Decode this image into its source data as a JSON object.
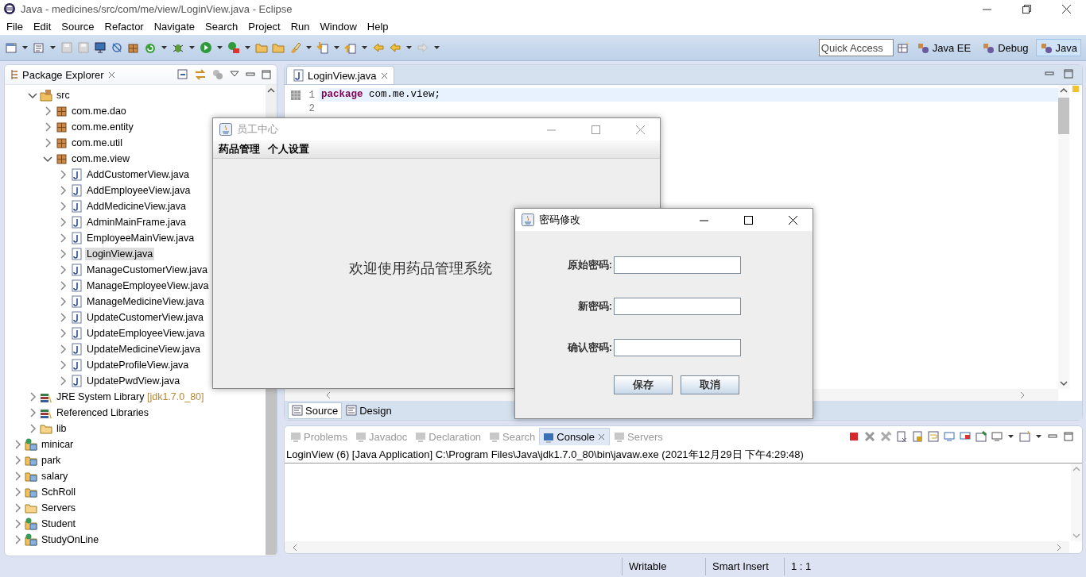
{
  "window": {
    "title": "Java - medicines/src/com/me/view/LoginView.java - Eclipse"
  },
  "menu": [
    "File",
    "Edit",
    "Source",
    "Refactor",
    "Navigate",
    "Search",
    "Project",
    "Run",
    "Window",
    "Help"
  ],
  "quick_access": {
    "placeholder": "Quick Access"
  },
  "perspectives": [
    {
      "label": "Java EE",
      "selected": false
    },
    {
      "label": "Debug",
      "selected": false
    },
    {
      "label": "Java",
      "selected": true
    }
  ],
  "package_explorer": {
    "title": "Package Explorer",
    "project_contents": [
      {
        "label": "src",
        "kind": "source-folder",
        "expanded": true,
        "selected": false,
        "children": [
          {
            "label": "com.me.dao",
            "kind": "package",
            "expanded": false,
            "selected": false
          },
          {
            "label": "com.me.entity",
            "kind": "package",
            "expanded": false,
            "selected": false
          },
          {
            "label": "com.me.util",
            "kind": "package",
            "expanded": false,
            "selected": false
          },
          {
            "label": "com.me.view",
            "kind": "package",
            "expanded": true,
            "selected": false,
            "children": [
              {
                "label": "AddCustomerView.java",
                "kind": "java-file",
                "expanded": false,
                "selected": false
              },
              {
                "label": "AddEmployeeView.java",
                "kind": "java-file",
                "expanded": false,
                "selected": false
              },
              {
                "label": "AddMedicineView.java",
                "kind": "java-file",
                "expanded": false,
                "selected": false
              },
              {
                "label": "AdminMainFrame.java",
                "kind": "java-file",
                "expanded": false,
                "selected": false
              },
              {
                "label": "EmployeeMainView.java",
                "kind": "java-file",
                "expanded": false,
                "selected": false
              },
              {
                "label": "LoginView.java",
                "kind": "java-file",
                "expanded": false,
                "selected": true
              },
              {
                "label": "ManageCustomerView.java",
                "kind": "java-file",
                "expanded": false,
                "selected": false
              },
              {
                "label": "ManageEmployeeView.java",
                "kind": "java-file",
                "expanded": false,
                "selected": false
              },
              {
                "label": "ManageMedicineView.java",
                "kind": "java-file",
                "expanded": false,
                "selected": false
              },
              {
                "label": "UpdateCustomerView.java",
                "kind": "java-file",
                "expanded": false,
                "selected": false
              },
              {
                "label": "UpdateEmployeeView.java",
                "kind": "java-file",
                "expanded": false,
                "selected": false
              },
              {
                "label": "UpdateMedicineView.java",
                "kind": "java-file",
                "expanded": false,
                "selected": false
              },
              {
                "label": "UpdateProfileView.java",
                "kind": "java-file",
                "expanded": false,
                "selected": false
              },
              {
                "label": "UpdatePwdView.java",
                "kind": "java-file",
                "expanded": false,
                "selected": false
              }
            ]
          }
        ]
      },
      {
        "label": "JRE System Library",
        "decoration": "[jdk1.7.0_80]",
        "kind": "library",
        "expanded": false,
        "selected": false
      },
      {
        "label": "Referenced Libraries",
        "kind": "library",
        "expanded": false,
        "selected": false
      },
      {
        "label": "lib",
        "kind": "folder",
        "expanded": false,
        "selected": false
      }
    ],
    "projects": [
      {
        "label": "minicar",
        "kind": "web-project",
        "expanded": false,
        "selected": false
      },
      {
        "label": "park",
        "kind": "project",
        "expanded": false,
        "selected": false
      },
      {
        "label": "salary",
        "kind": "project",
        "expanded": false,
        "selected": false
      },
      {
        "label": "SchRoll",
        "kind": "project",
        "expanded": false,
        "selected": false
      },
      {
        "label": "Servers",
        "kind": "folder",
        "expanded": false,
        "selected": false
      },
      {
        "label": "Student",
        "kind": "web-project",
        "expanded": false,
        "selected": false
      },
      {
        "label": "StudyOnLine",
        "kind": "web-project",
        "expanded": false,
        "selected": false
      }
    ]
  },
  "editor": {
    "tab": "LoginView.java",
    "lines": [
      {
        "number": "1",
        "current": true,
        "tokens": [
          {
            "kind": "keyword",
            "text": "package"
          },
          {
            "kind": "plain",
            "text": " com.me.view;"
          }
        ]
      },
      {
        "number": "2",
        "current": false
      }
    ],
    "bottom_tabs": [
      {
        "label": "Source",
        "selected": true
      },
      {
        "label": "Design",
        "selected": false
      }
    ]
  },
  "console": {
    "tabs": [
      {
        "label": "Problems",
        "selected": false
      },
      {
        "label": "Javadoc",
        "selected": false
      },
      {
        "label": "Declaration",
        "selected": false
      },
      {
        "label": "Search",
        "selected": false
      },
      {
        "label": "Console",
        "selected": true
      },
      {
        "label": "Servers",
        "selected": false
      }
    ],
    "launch": "LoginView (6) [Java Application] C:\\Program Files\\Java\\jdk1.7.0_80\\bin\\javaw.exe (2021年12月29日 下午4:29:48)"
  },
  "status_bar": [
    "Writable",
    "Smart Insert",
    "1 : 1"
  ],
  "employee_window": {
    "title": "员工中心",
    "menu": [
      "药品管理",
      "个人设置"
    ],
    "welcome": "欢迎使用药品管理系统"
  },
  "password_dialog": {
    "title": "密码修改",
    "fields": [
      {
        "label": "原始密码:"
      },
      {
        "label": "新密码:"
      },
      {
        "label": "确认密码:"
      }
    ],
    "buttons": [
      "保存",
      "取消"
    ]
  }
}
